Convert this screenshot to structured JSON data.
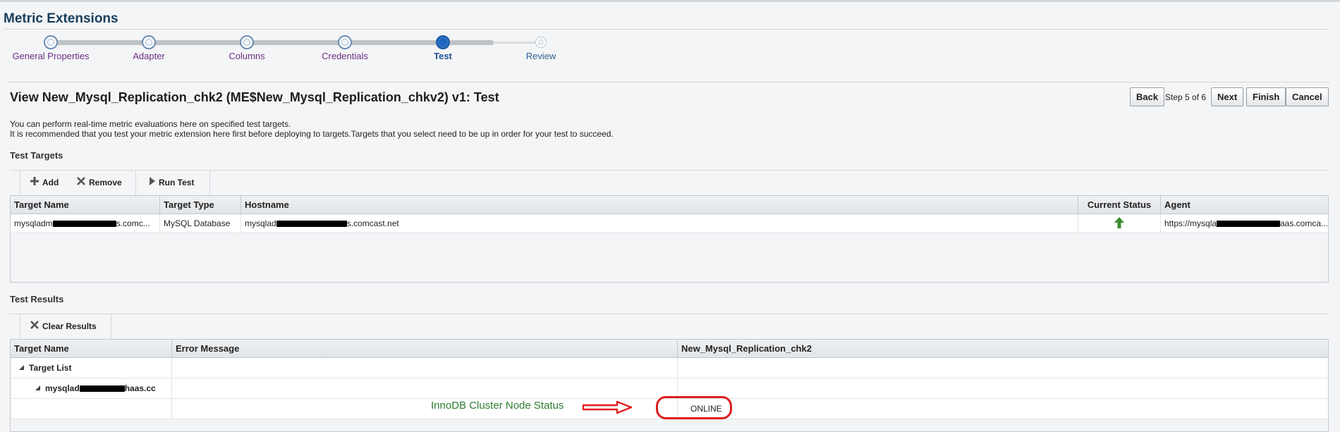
{
  "app": {
    "title": "Metric Extensions"
  },
  "train": {
    "steps": [
      {
        "label": "General Properties",
        "state": "done"
      },
      {
        "label": "Adapter",
        "state": "done"
      },
      {
        "label": "Columns",
        "state": "done"
      },
      {
        "label": "Credentials",
        "state": "done"
      },
      {
        "label": "Test",
        "state": "current"
      },
      {
        "label": "Review",
        "state": "todo"
      }
    ]
  },
  "page": {
    "heading": "View New_Mysql_Replication_chk2 (ME$New_Mysql_Replication_chkv2) v1: Test",
    "desc_line1": "You can perform real-time metric evaluations here on specified test targets.",
    "desc_line2": "It is recommended that you test your metric extension here first before deploying to targets.Targets that you select need to be up in order for your test to succeed."
  },
  "nav": {
    "back": "Back",
    "step": "Step 5 of 6",
    "next": "Next",
    "finish": "Finish",
    "cancel": "Cancel"
  },
  "test_targets": {
    "heading": "Test Targets",
    "toolbar": {
      "add": "Add",
      "remove": "Remove",
      "run": "Run Test"
    },
    "columns": [
      "Target Name",
      "Target Type",
      "Hostname",
      "Current Status",
      "Agent"
    ],
    "row": {
      "target_name_a": "mysqladm",
      "target_name_b": "s.comc...",
      "target_type": "MySQL Database",
      "hostname_a": "mysqlad",
      "hostname_b": "s.comcast.net",
      "status_icon": "up-arrow-icon",
      "agent_a": "https://mysqla",
      "agent_b": "aas.comca..."
    }
  },
  "test_results": {
    "heading": "Test Results",
    "toolbar": {
      "clear": "Clear Results"
    },
    "columns": [
      "Target Name",
      "Error Message",
      "New_Mysql_Replication_chk2"
    ],
    "rows": {
      "group": "Target List",
      "target_a": "mysqlad",
      "target_b": "haas.cc",
      "value": "ONLINE"
    },
    "annotation": "InnoDB Cluster Node Status"
  },
  "colors": {
    "accent": "#173e5c",
    "status_up": "#3d8c2f",
    "annotation_green": "#2e7d32",
    "highlight_red": "#e01e1e"
  }
}
